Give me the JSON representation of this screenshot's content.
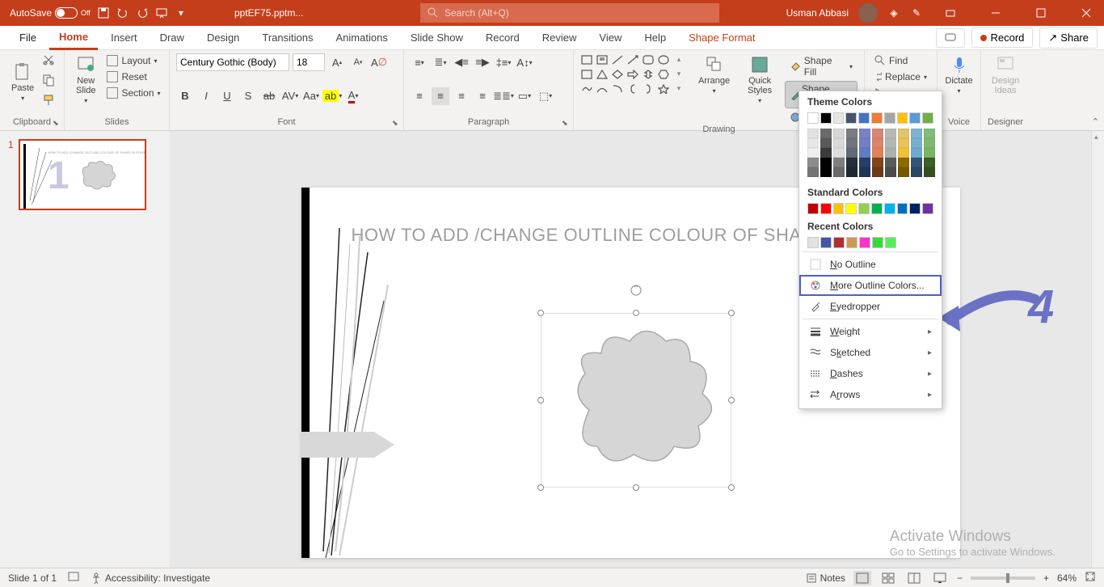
{
  "titlebar": {
    "autosave": "AutoSave",
    "autosave_state": "Off",
    "filename": "pptEF75.pptm...",
    "search_placeholder": "Search (Alt+Q)",
    "user": "Usman Abbasi"
  },
  "tabs": {
    "file": "File",
    "home": "Home",
    "insert": "Insert",
    "draw": "Draw",
    "design": "Design",
    "transitions": "Transitions",
    "animations": "Animations",
    "slideshow": "Slide Show",
    "record_tab": "Record",
    "review": "Review",
    "view": "View",
    "help": "Help",
    "shape_format": "Shape Format",
    "record_btn": "Record",
    "share": "Share"
  },
  "ribbon": {
    "clipboard": {
      "paste": "Paste",
      "label": "Clipboard"
    },
    "slides": {
      "new_slide": "New\nSlide",
      "layout": "Layout",
      "reset": "Reset",
      "section": "Section",
      "label": "Slides"
    },
    "font": {
      "family": "Century Gothic (Body)",
      "size": "18",
      "label": "Font"
    },
    "paragraph": {
      "label": "Paragraph"
    },
    "drawing": {
      "arrange": "Arrange",
      "quick_styles": "Quick\nStyles",
      "shape_fill": "Shape Fill",
      "shape_outline": "Shape Outline",
      "label": "Drawing"
    },
    "editing": {
      "find": "Find",
      "replace": "Replace",
      "label": "Editing"
    },
    "voice": {
      "dictate": "Dictate",
      "label": "Voice"
    },
    "designer": {
      "design_ideas": "Design\nIdeas",
      "label": "Designer"
    }
  },
  "dropdown": {
    "theme_colors": "Theme Colors",
    "standard_colors": "Standard Colors",
    "recent_colors": "Recent Colors",
    "no_outline": "No Outline",
    "more_colors": "More Outline Colors...",
    "eyedropper": "Eyedropper",
    "weight": "Weight",
    "sketched": "Sketched",
    "dashes": "Dashes",
    "arrows": "Arrows",
    "theme_row": [
      "#ffffff",
      "#000000",
      "#e7e6e6",
      "#44546a",
      "#4472c4",
      "#ed7d31",
      "#a5a5a5",
      "#ffc000",
      "#5b9bd5",
      "#70ad47"
    ],
    "standard": [
      "#c00000",
      "#ff0000",
      "#ffc000",
      "#ffff00",
      "#92d050",
      "#00b050",
      "#00b0f0",
      "#0070c0",
      "#002060",
      "#7030a0"
    ],
    "recent": [
      "#e2e2e2",
      "#4455aa",
      "#b03030",
      "#cc9955",
      "#ff33cc",
      "#33dd33",
      "#55ee55"
    ]
  },
  "slide": {
    "number": "1",
    "title": "HOW TO ADD /CHANGE OUTLINE COLOUR OF SHAPE IN P"
  },
  "annotation": {
    "step": "4"
  },
  "activate": {
    "line1": "Activate Windows",
    "line2": "Go to Settings to activate Windows."
  },
  "statusbar": {
    "slide_of": "Slide 1 of 1",
    "accessibility": "Accessibility: Investigate",
    "notes": "Notes",
    "zoom": "64%"
  }
}
